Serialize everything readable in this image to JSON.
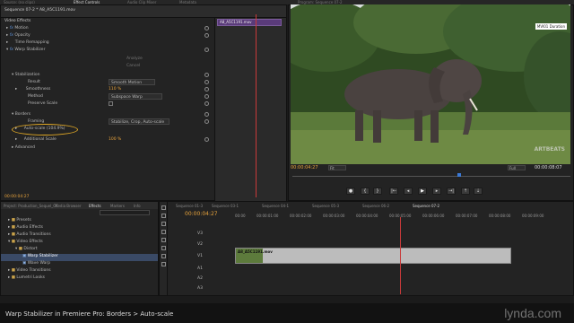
{
  "top_tabs": [
    "Source: (no clips)",
    "Effect Controls",
    "Audio Clip Mixer",
    "Metadata",
    "Program: Sequence 07-2"
  ],
  "effect_controls": {
    "sequence_clip": "Sequence 07-2 * A8_A5C1191.mov",
    "clip_chip": "A8_A5C1191.mov",
    "video_effects_label": "Video Effects",
    "rows": [
      {
        "label": "Motion",
        "fx": "fx"
      },
      {
        "label": "Opacity",
        "fx": "fx"
      },
      {
        "label": "Time Remapping",
        "fx": ""
      },
      {
        "label": "Warp Stabilizer",
        "fx": "fx"
      }
    ],
    "analyze": "Analyze",
    "cancel": "Cancel",
    "stabilization": "Stabilization",
    "result_label": "Result",
    "result_value": "Smooth Motion",
    "smoothness_label": "Smoothness",
    "smoothness_value": "110 %",
    "method_label": "Method",
    "method_value": "Subspace Warp",
    "preserve_label": "Preserve Scale",
    "borders": "Borders",
    "framing_label": "Framing",
    "framing_value": "Stabilize, Crop, Auto-scale",
    "autoscale_label": "Auto-scale (104.9%)",
    "additional_label": "Additional Scale",
    "additional_value": "100 %",
    "advanced": "Advanced",
    "timecode": "00:00:04:27"
  },
  "program": {
    "overlay_label": "MVI01 Duration",
    "watermark": "ARTBEATS",
    "timecode_left": "00:00:04:27",
    "fit": "Fit",
    "quality": "Full",
    "timecode_right": "00:00:08:07"
  },
  "project": {
    "tabs": [
      "Project: Production_Sequel_CC",
      "Media Browser",
      "Effects",
      "Markers",
      "Info"
    ],
    "search_placeholder": "",
    "tree": [
      {
        "label": "Presets",
        "indent": 0,
        "icon": "folder-icon"
      },
      {
        "label": "Audio Effects",
        "indent": 0,
        "icon": "folder-icon"
      },
      {
        "label": "Audio Transitions",
        "indent": 0,
        "icon": "folder-icon"
      },
      {
        "label": "Video Effects",
        "indent": 0,
        "icon": "folder-icon"
      },
      {
        "label": "Distort",
        "indent": 1,
        "icon": "folder-icon"
      },
      {
        "label": "Warp Stabilizer",
        "indent": 2,
        "icon": "effect-icon"
      },
      {
        "label": "Wave Warp",
        "indent": 2,
        "icon": "effect-icon"
      },
      {
        "label": "Video Transitions",
        "indent": 0,
        "icon": "folder-icon"
      },
      {
        "label": "Lumetri Looks",
        "indent": 0,
        "icon": "folder-icon"
      }
    ]
  },
  "timeline": {
    "tabs": [
      "Sequence 01-3",
      "Sequence 03-1",
      "Sequence 04-1",
      "Sequence 05-3",
      "Sequence 06-2",
      "Sequence 07-2"
    ],
    "timecode": "00:00:04:27",
    "ruler": [
      "00:00",
      "00:00:01:00",
      "00:00:02:00",
      "00:00:03:00",
      "00:00:04:00",
      "00:00:05:00",
      "00:00:06:00",
      "00:00:07:00",
      "00:00:08:00",
      "00:00:09:00"
    ],
    "tracks": [
      "V3",
      "V2",
      "V1",
      "A1",
      "A2",
      "A3"
    ],
    "clip_label": "A8_A5C1191.mov"
  },
  "caption": {
    "title": "Warp Stabilizer in Premiere Pro: Borders > Auto-scale",
    "brand": "lynda.com"
  }
}
